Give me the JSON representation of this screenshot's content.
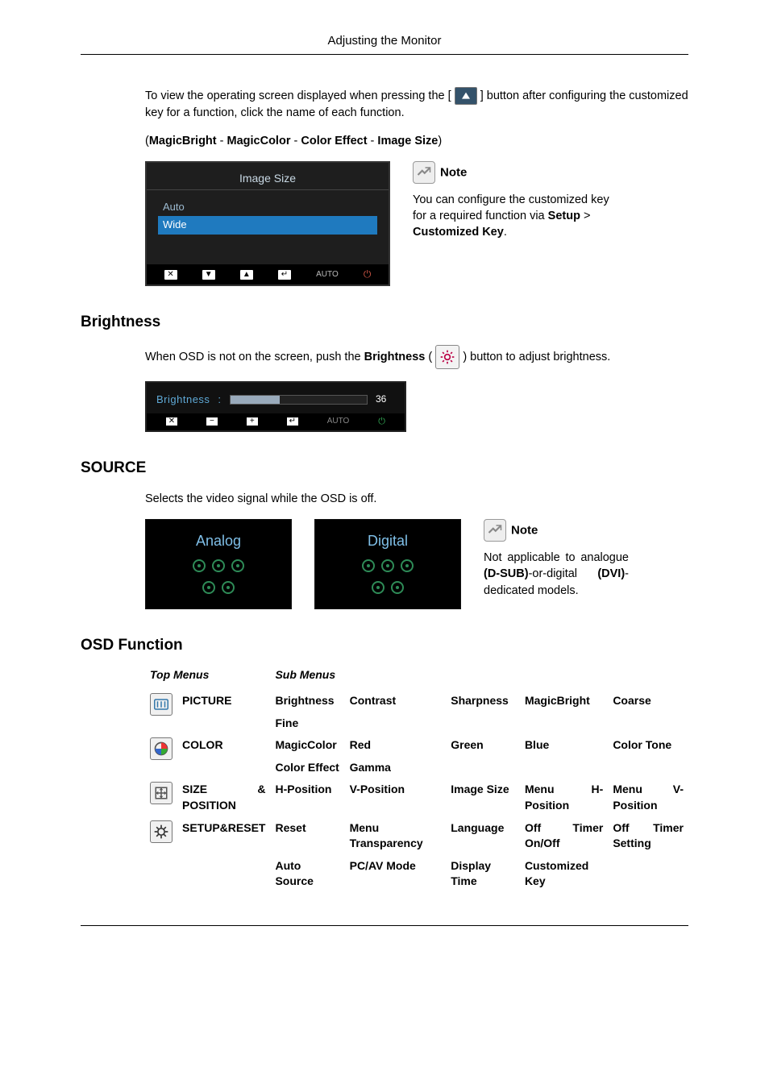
{
  "header": {
    "title": "Adjusting the Monitor"
  },
  "intro": {
    "text_pre": "To view the operating screen displayed when pressing the [",
    "text_post": "] button after configuring the customized key for a function, click the name of each function.",
    "links_line_open": "(",
    "link1": "MagicBright",
    "sep": " - ",
    "link2": "MagicColor",
    "link3": "Color Effect",
    "link4": "Image Size",
    "links_line_close": ")"
  },
  "osd_imagesize": {
    "title": "Image Size",
    "opt1": "Auto",
    "opt2": "Wide",
    "key_x": "✕",
    "key_down": "▼",
    "key_up": "▲",
    "key_enter": "↵",
    "auto": "AUTO",
    "power": "⏻"
  },
  "note1": {
    "label": "Note",
    "text_pre": "You can configure the customized key for a required function via ",
    "setup": "Setup",
    "gt": " > ",
    "custkey": "Customized Key",
    "dot": "."
  },
  "brightness": {
    "heading": "Brightness",
    "text_pre": "When OSD is not on the screen, push the ",
    "label": "Brightness",
    "text_mid": " (",
    "text_post": ") button to adjust brightness.",
    "osd_label": "Brightness",
    "osd_colon": ":",
    "osd_value": "36",
    "key_x": "✕",
    "key_minus": "−",
    "key_plus": "+",
    "key_enter": "↵",
    "auto": "AUTO",
    "power": "⏻"
  },
  "source": {
    "heading": "SOURCE",
    "desc": "Selects the video signal while the OSD is off.",
    "opt1": "Analog",
    "opt2": "Digital",
    "note_label": "Note",
    "note_text_pre": "Not applicable to analogue ",
    "dsub": "(D-SUB)",
    "note_text_mid": "-or-digital ",
    "dvi": "(DVI)",
    "note_text_post": "-dedicated models."
  },
  "osdfunc": {
    "heading": "OSD Function",
    "th1": "Top Menus",
    "th2": "Sub Menus",
    "rows": {
      "picture": {
        "name": "PICTURE",
        "s1": "Brightness",
        "s2": "Contrast",
        "s3": "Sharpness",
        "s4": "MagicBright",
        "s5": "Coarse",
        "s6": "Fine"
      },
      "color": {
        "name": "COLOR",
        "s1": "MagicColor",
        "s2": "Red",
        "s3": "Green",
        "s4": "Blue",
        "s5": "Color Tone",
        "s6": "Color Effect",
        "s7": "Gamma"
      },
      "size": {
        "name": "SIZE & POSITION",
        "s1": "H-Position",
        "s2": "V-Position",
        "s3": "Image Size",
        "s4": "Menu H-Position",
        "s5": "Menu V-Position"
      },
      "setup": {
        "name": "SETUP&RESET",
        "s1": "Reset",
        "s2": "Menu Transparency",
        "s3": "Language",
        "s4": "Off Timer On/Off",
        "s5": "Off Timer Setting",
        "s6": "Auto Source",
        "s7": "PC/AV Mode",
        "s8": "Display Time",
        "s9": "Customized Key"
      }
    }
  }
}
